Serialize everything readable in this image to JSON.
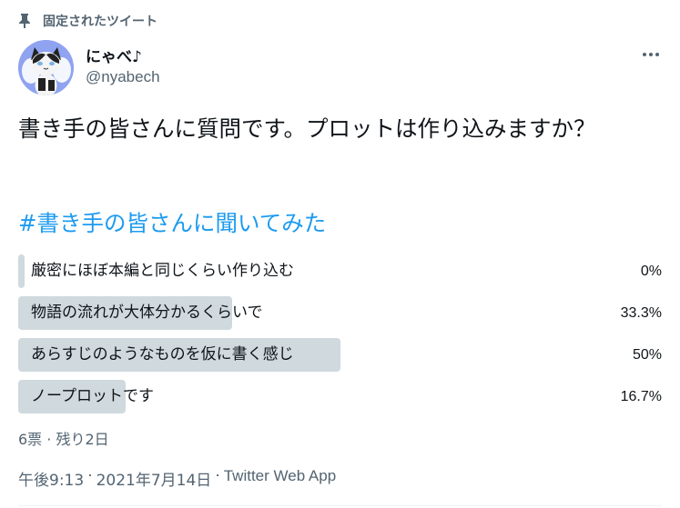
{
  "pinned": {
    "label": "固定されたツイート",
    "icon": "pin-icon"
  },
  "author": {
    "display_name": "にゃべ♪",
    "handle": "@nyabech",
    "avatar_icon": "avatar-cat"
  },
  "tweet": {
    "text": "書き手の皆さんに質問です。プロットは作り込みますか？",
    "hashtag": "#書き手の皆さんに聞いてみた"
  },
  "poll": {
    "options": [
      {
        "label": "厳密にほぼ本編と同じくらい作り込む",
        "percent_text": "0%",
        "percent": 0
      },
      {
        "label": "物語の流れが大体分かるくらいで",
        "percent_text": "33.3%",
        "percent": 33.3
      },
      {
        "label": "あらすじのようなものを仮に書く感じ",
        "percent_text": "50%",
        "percent": 50
      },
      {
        "label": "ノープロットです",
        "percent_text": "16.7%",
        "percent": 16.7
      }
    ],
    "meta": "6票 · 残り2日"
  },
  "timestamp": {
    "time": "午後9:13",
    "separator": "·",
    "date": "2021年7月14日",
    "source": "Twitter Web App"
  },
  "colors": {
    "hashtag": "#1d9bf0",
    "poll_bar": "#cfd9de",
    "secondary_text": "#536471",
    "primary_text": "#0f1419"
  }
}
